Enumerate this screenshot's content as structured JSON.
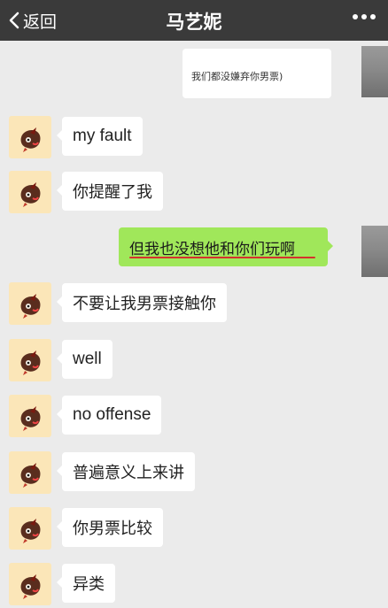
{
  "header": {
    "back_label": "返回",
    "title": "马艺妮"
  },
  "colors": {
    "header_bg": "#3a3a3a",
    "chat_bg": "#ebebeb",
    "outgoing_bubble": "#a0e75a",
    "incoming_bubble": "#ffffff",
    "underline": "#d4322c"
  },
  "messages": [
    {
      "from": "me",
      "text": "我们都没嫌弃你男票)"
    },
    {
      "from": "other",
      "text": "my fault"
    },
    {
      "from": "other",
      "text": "你提醒了我"
    },
    {
      "from": "me",
      "text": "但我也没想他和你们玩啊"
    },
    {
      "from": "other",
      "text": "不要让我男票接触你"
    },
    {
      "from": "other",
      "text": "well"
    },
    {
      "from": "other",
      "text": "no offense"
    },
    {
      "from": "other",
      "text": "普遍意义上来讲"
    },
    {
      "from": "other",
      "text": "你男票比较"
    },
    {
      "from": "other",
      "text": "异类"
    }
  ]
}
